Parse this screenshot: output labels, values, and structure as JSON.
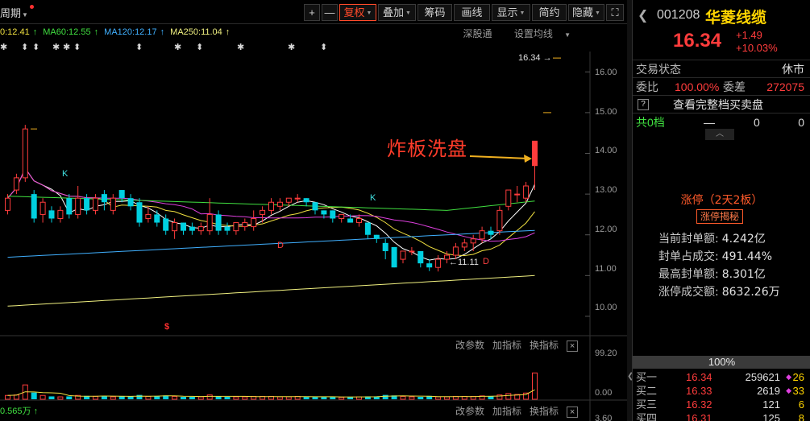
{
  "toolbar": {
    "period_label": "周期",
    "buttons": [
      {
        "label": "+",
        "active": false
      },
      {
        "label": "—",
        "active": false
      },
      {
        "label": "复权",
        "active": true,
        "caret": true
      },
      {
        "label": "叠加",
        "active": false,
        "caret": true
      },
      {
        "label": "筹码",
        "active": false
      },
      {
        "label": "画线",
        "active": false
      },
      {
        "label": "显示",
        "active": false,
        "caret": true
      },
      {
        "label": "简约",
        "active": false
      },
      {
        "label": "隐藏",
        "active": false,
        "caret": true
      },
      {
        "label": "⛶",
        "active": false
      }
    ]
  },
  "ma_legend": {
    "ma_partial": "0:12.41",
    "ma60": "MA60:12.55",
    "ma120": "MA120:12.17",
    "ma250": "MA250:11.04",
    "shenzhen_link": "深股通",
    "settings_label": "设置均线"
  },
  "price_axis": [
    "16.00",
    "15.00",
    "14.00",
    "13.00",
    "12.00",
    "11.00",
    "10.00"
  ],
  "annotation": "炸板洗盘",
  "current_price_tag": "16.34",
  "low_tag": "11.11",
  "markers": {
    "k1": "K",
    "k2": "K",
    "d1": "D",
    "d2": "D",
    "s": "$"
  },
  "volume_panel": {
    "change_params": "改参数",
    "add_indicator": "加指标",
    "switch_indicator": "换指标",
    "close": "×",
    "axis_top": "99.20",
    "axis_bottom": "0.00",
    "axis_footer": "3.60",
    "footer_value": "0.565万"
  },
  "side": {
    "code": "001208",
    "name": "华菱线缆",
    "price": "16.34",
    "change": "+1.49",
    "change_pct": "+10.03%",
    "trade_status_label": "交易状态",
    "trade_status_value": "休市",
    "commit_ratio_label": "委比",
    "commit_ratio_value": "100.00%",
    "commit_diff_label": "委差",
    "commit_diff_value": "272075",
    "full_book_label": "查看完整档买卖盘",
    "total_levels_label": "共0档",
    "total_levels_dash": "—",
    "total_levels_v1": "0",
    "total_levels_v2": "0",
    "limit_title": "涨停（2天2板）",
    "limit_button": "涨停揭秘",
    "stats": [
      {
        "label": "当前封单额:",
        "value": "4.242亿"
      },
      {
        "label": "封单占成交:",
        "value": "491.44%"
      },
      {
        "label": "最高封单额:",
        "value": "8.301亿"
      },
      {
        "label": "涨停成交额:",
        "value": "8632.26万"
      }
    ],
    "percent_bar": "100%",
    "bids": [
      {
        "label": "买一",
        "price": "16.34",
        "volume": "259621",
        "count": "26"
      },
      {
        "label": "买二",
        "price": "16.33",
        "volume": "2619",
        "count": "33"
      },
      {
        "label": "买三",
        "price": "16.32",
        "volume": "121",
        "count": "6"
      },
      {
        "label": "买四",
        "price": "16.31",
        "volume": "125",
        "count": "8"
      }
    ]
  },
  "colors": {
    "up": "#ff3c3c",
    "down": "#00d0e0",
    "ma5": "#ffffff",
    "ma10": "#f0e040",
    "ma20": "#e040e0",
    "ma60": "#40e040",
    "ma120": "#40b0ff",
    "ma250": "#f0f080",
    "accent": "#ff5a2a"
  },
  "chart_data": {
    "type": "candlestick",
    "ylim": [
      9.9,
      16.5
    ],
    "candles": [
      [
        12.6,
        12.9,
        12.5,
        13.0
      ],
      [
        13.1,
        13.4,
        13.0,
        13.5
      ],
      [
        13.4,
        14.6,
        13.3,
        14.7
      ],
      [
        13.0,
        12.4,
        12.3,
        13.1
      ],
      [
        12.5,
        12.8,
        12.3,
        12.9
      ],
      [
        12.6,
        12.4,
        12.3,
        12.7
      ],
      [
        12.4,
        12.6,
        12.3,
        12.7
      ],
      [
        12.9,
        12.5,
        12.4,
        13.0
      ],
      [
        12.5,
        12.9,
        12.4,
        13.2
      ],
      [
        12.9,
        12.6,
        12.5,
        13.0
      ],
      [
        12.6,
        12.9,
        12.5,
        13.0
      ],
      [
        13.0,
        12.8,
        12.6,
        13.1
      ],
      [
        12.6,
        12.9,
        12.5,
        13.0
      ],
      [
        13.1,
        12.9,
        12.8,
        13.1
      ],
      [
        12.9,
        12.7,
        12.6,
        13.0
      ],
      [
        12.8,
        12.3,
        12.2,
        12.9
      ],
      [
        12.4,
        12.5,
        12.3,
        12.7
      ],
      [
        12.5,
        12.3,
        12.2,
        12.6
      ],
      [
        12.4,
        12.1,
        12.0,
        12.5
      ],
      [
        12.1,
        12.3,
        11.9,
        12.4
      ],
      [
        12.3,
        12.1,
        12.0,
        12.3
      ],
      [
        12.2,
        12.1,
        12.0,
        12.3
      ],
      [
        12.1,
        12.2,
        12.0,
        12.3
      ],
      [
        12.1,
        12.5,
        12.0,
        12.9
      ],
      [
        12.5,
        12.1,
        12.0,
        12.6
      ],
      [
        12.2,
        12.1,
        12.0,
        12.3
      ],
      [
        12.1,
        12.3,
        12.0,
        12.3
      ],
      [
        12.2,
        12.3,
        12.1,
        12.4
      ],
      [
        12.2,
        12.4,
        12.1,
        12.6
      ],
      [
        12.5,
        12.6,
        12.3,
        12.7
      ],
      [
        12.6,
        12.8,
        12.5,
        12.9
      ],
      [
        12.7,
        12.8,
        12.6,
        12.9
      ],
      [
        12.8,
        12.9,
        12.7,
        12.9
      ],
      [
        12.9,
        12.9,
        12.8,
        13.0
      ],
      [
        12.9,
        12.8,
        12.7,
        12.9
      ],
      [
        12.8,
        12.6,
        12.5,
        12.8
      ],
      [
        12.6,
        12.5,
        12.4,
        12.6
      ],
      [
        12.6,
        12.4,
        12.3,
        12.6
      ],
      [
        12.4,
        12.5,
        12.3,
        12.5
      ],
      [
        12.4,
        12.3,
        12.3,
        12.5
      ],
      [
        12.3,
        12.4,
        12.2,
        12.5
      ],
      [
        12.3,
        12.0,
        11.9,
        12.3
      ],
      [
        12.0,
        11.9,
        11.8,
        12.0
      ],
      [
        11.8,
        11.6,
        11.4,
        11.9
      ],
      [
        11.7,
        11.2,
        11.2,
        11.7
      ],
      [
        11.4,
        11.6,
        11.3,
        11.6
      ],
      [
        11.6,
        11.6,
        11.5,
        11.7
      ],
      [
        11.6,
        11.3,
        11.2,
        11.6
      ],
      [
        11.3,
        11.2,
        11.11,
        11.4
      ],
      [
        11.2,
        11.4,
        11.1,
        11.5
      ],
      [
        11.4,
        11.5,
        11.3,
        11.6
      ],
      [
        11.5,
        11.7,
        11.4,
        11.8
      ],
      [
        11.7,
        11.8,
        11.6,
        11.9
      ],
      [
        11.8,
        11.9,
        11.6,
        12.0
      ],
      [
        11.9,
        12.1,
        11.8,
        12.2
      ],
      [
        12.1,
        12.0,
        11.9,
        12.2
      ],
      [
        12.1,
        12.6,
        12.0,
        12.7
      ],
      [
        12.7,
        13.1,
        12.6,
        13.1
      ],
      [
        13.0,
        13.0,
        12.8,
        13.2
      ],
      [
        12.9,
        13.2,
        12.8,
        13.3
      ],
      [
        13.7,
        14.3,
        13.1,
        14.3
      ]
    ],
    "volumes": [
      8,
      9,
      30,
      14,
      8,
      6,
      5,
      6,
      8,
      7,
      6,
      7,
      5,
      6,
      6,
      9,
      6,
      6,
      8,
      6,
      5,
      5,
      5,
      9,
      6,
      5,
      5,
      5,
      6,
      6,
      6,
      5,
      5,
      6,
      5,
      5,
      5,
      5,
      4,
      5,
      5,
      6,
      6,
      9,
      8,
      6,
      5,
      5,
      7,
      5,
      5,
      6,
      6,
      6,
      7,
      6,
      9,
      12,
      10,
      13,
      55
    ],
    "vol_ylim": [
      0,
      99.2
    ]
  }
}
